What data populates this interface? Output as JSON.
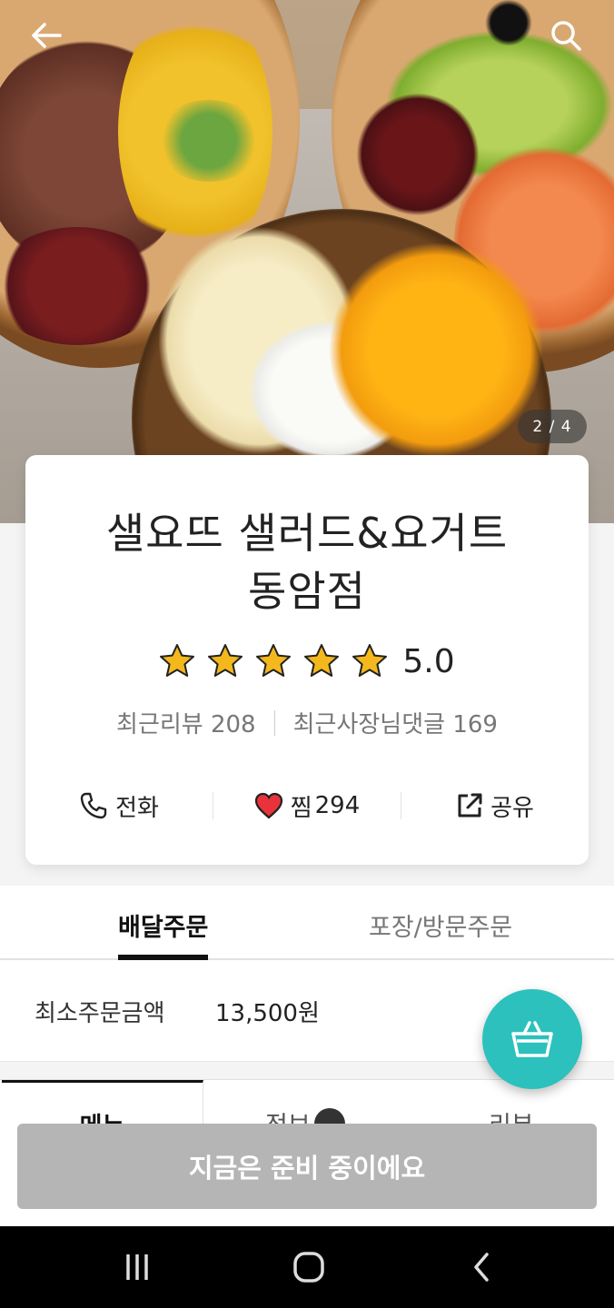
{
  "hero": {
    "image_counter": "2 / 4"
  },
  "store": {
    "name_line1": "샐요뜨 샐러드&요거트",
    "name_line2": "동암점",
    "rating": "5.0",
    "star_count": 5,
    "recent_reviews": "최근리뷰 208",
    "owner_replies": "최근사장님댓글 169"
  },
  "actions": {
    "call": "전화",
    "like_label": "찜",
    "like_count": "294",
    "share": "공유"
  },
  "order_tabs": {
    "delivery": "배달주문",
    "pickup": "포장/방문주문"
  },
  "min_order": {
    "label": "최소주문금액",
    "value": "13,500원"
  },
  "section_tabs": {
    "menu": "메뉴",
    "info": "정보",
    "review": "리뷰"
  },
  "bottom": {
    "status_button": "지금은 준비 중이에요"
  },
  "colors": {
    "fab": "#2cc1bd",
    "disabled_button": "#b5b5b5",
    "star": "#f5b81c",
    "heart": "#e8323c"
  }
}
